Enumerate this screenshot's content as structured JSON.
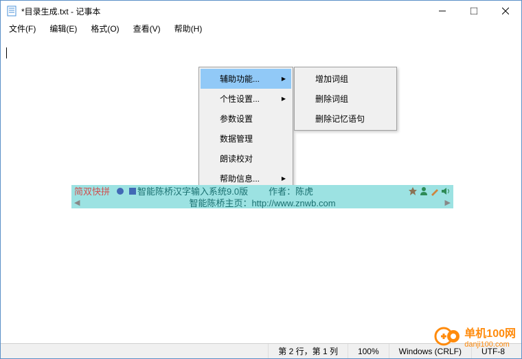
{
  "titlebar": {
    "text": "*目录生成.txt - 记事本"
  },
  "menubar": {
    "file": "文件(F)",
    "edit": "编辑(E)",
    "format": "格式(O)",
    "view": "查看(V)",
    "help": "帮助(H)"
  },
  "context_menu1": {
    "aux": "辅助功能...",
    "personal": "个性设置...",
    "params": "参数设置",
    "data": "数据管理",
    "read": "朗读校对",
    "helpinfo": "帮助信息..."
  },
  "context_menu2": {
    "add": "增加词组",
    "del": "删除词组",
    "delmem": "删除记忆语句"
  },
  "ime": {
    "name": "简双快拼",
    "title": "智能陈桥汉字输入系统9.0版",
    "author": "作者：陈虎",
    "homepage": "智能陈桥主页：http://www.znwb.com"
  },
  "statusbar": {
    "pos": "第 2 行，第 1 列",
    "zoom": "100%",
    "eol": "Windows (CRLF)",
    "enc": "UTF-8"
  },
  "watermark": {
    "line1": "单机100网",
    "line2": "danji100.com"
  }
}
